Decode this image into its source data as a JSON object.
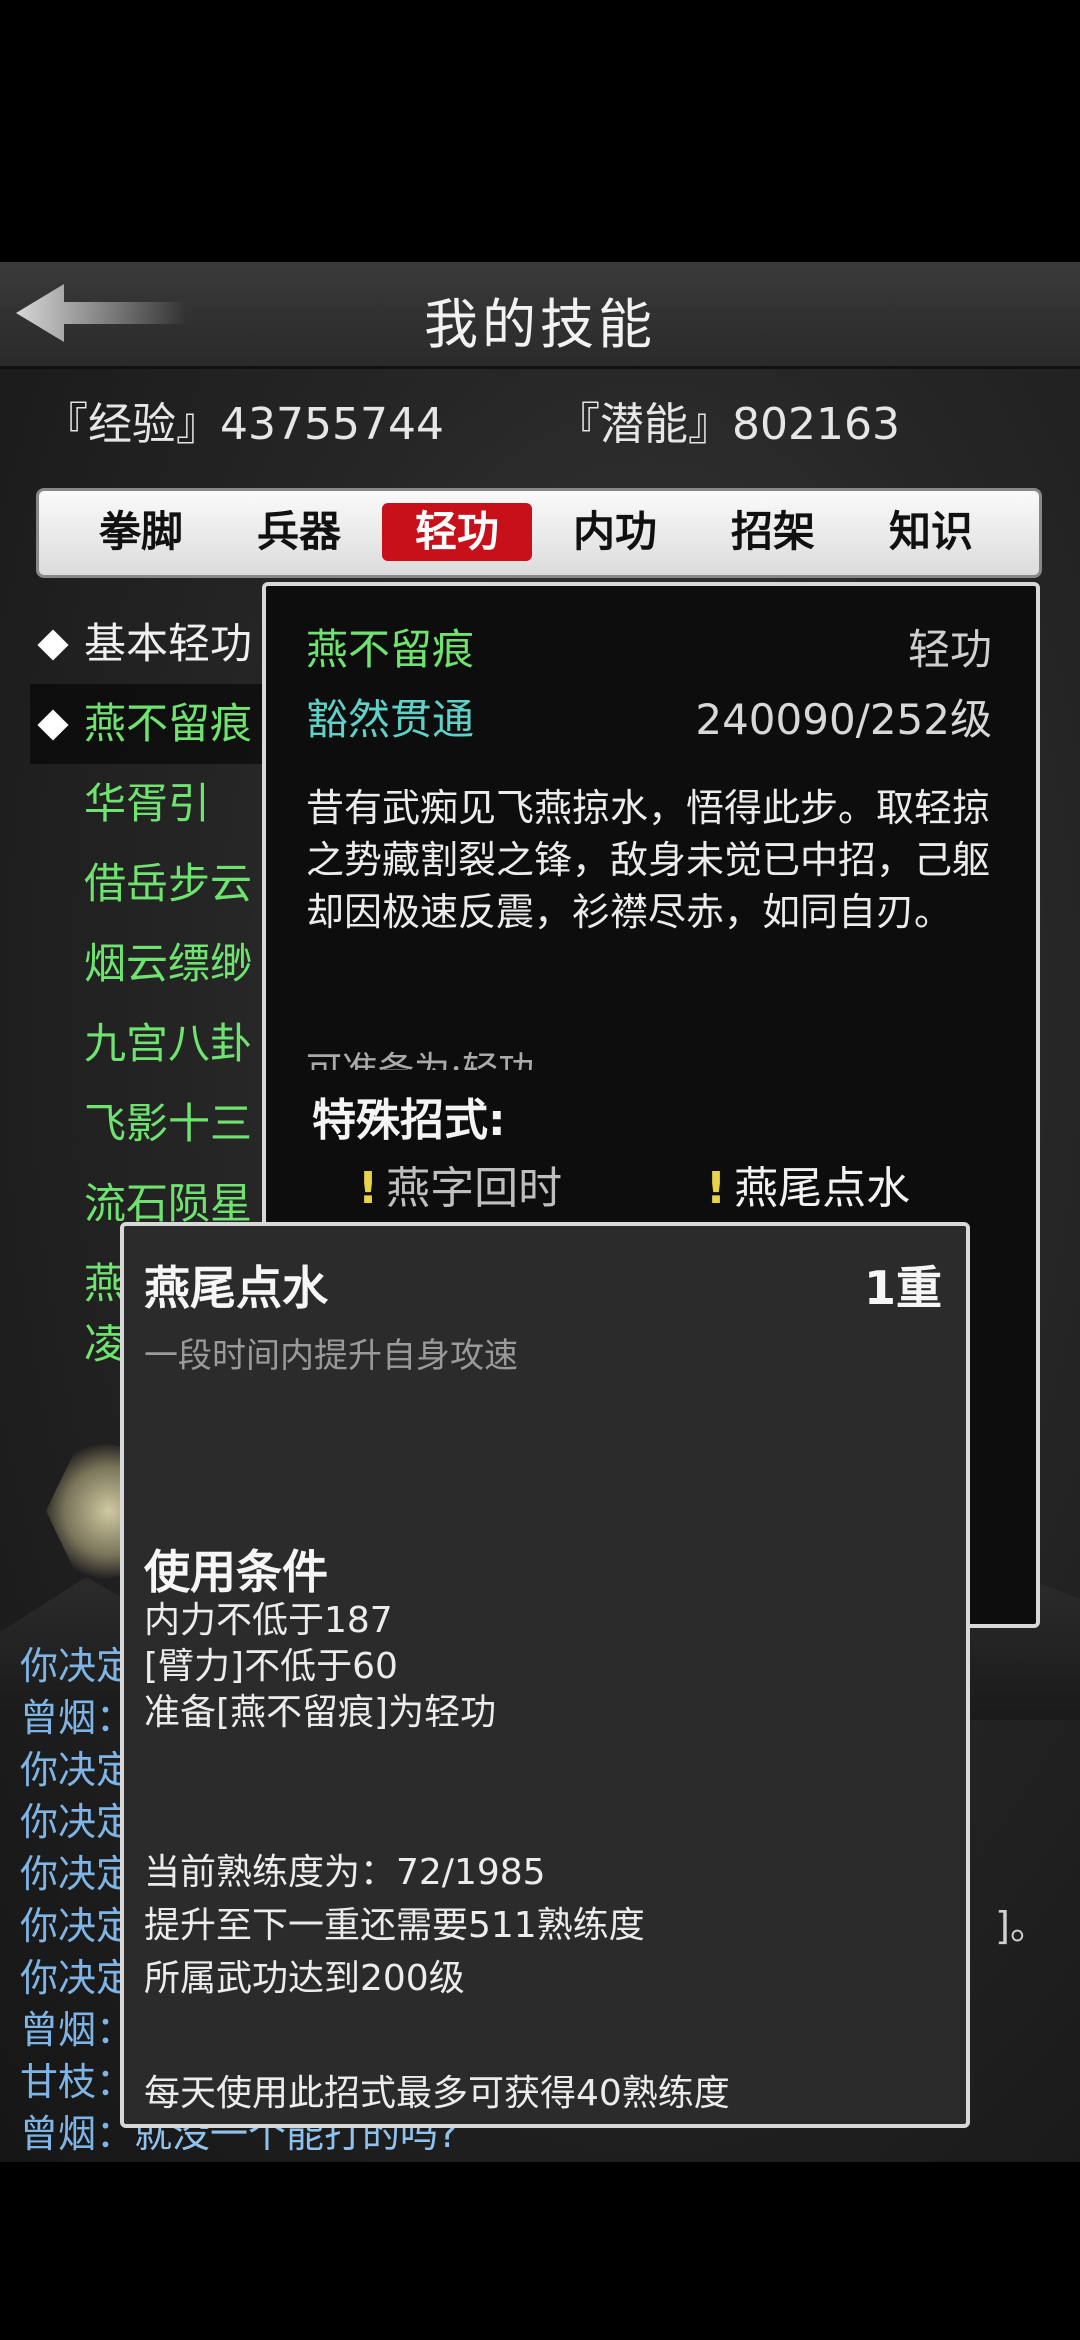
{
  "header": {
    "title": "我的技能"
  },
  "stats": {
    "experience": "『经验』43755744",
    "potential": "『潜能』802163"
  },
  "tabs": [
    {
      "label": "拳脚",
      "active": false
    },
    {
      "label": "兵器",
      "active": false
    },
    {
      "label": "轻功",
      "active": true
    },
    {
      "label": "内功",
      "active": false
    },
    {
      "label": "招架",
      "active": false
    },
    {
      "label": "知识",
      "active": false
    }
  ],
  "skill_list": {
    "groups": [
      {
        "label": "基本轻功"
      },
      {
        "label": "燕不留痕"
      }
    ],
    "items": [
      {
        "label": "华胥引"
      },
      {
        "label": "借岳步云"
      },
      {
        "label": "烟云缥缈"
      },
      {
        "label": "九宫八卦"
      },
      {
        "label": "飞影十三"
      },
      {
        "label": "流石陨星"
      },
      {
        "label": "燕"
      },
      {
        "label": "凌"
      }
    ]
  },
  "detail": {
    "name": "燕不留痕",
    "type": "轻功",
    "rank": "豁然贯通",
    "level": "240090/252级",
    "description": "昔有武痴见飞燕掠水，悟得此步。取轻掠之势藏割裂之锋，敌身未觉已中招，己躯却因极速反震，衫襟尽赤，如同自刃。",
    "equip_hint": "可准备为:轻功",
    "special_title": "特殊招式:",
    "special_moves": [
      {
        "label": "燕字回时"
      },
      {
        "label": "燕尾点水"
      }
    ]
  },
  "tooltip": {
    "name": "燕尾点水",
    "tier": "1重",
    "description": "一段时间内提升自身攻速",
    "conditions_title": "使用条件",
    "conditions": [
      "内力不低于187",
      "[臂力]不低于60",
      "准备[燕不留痕]为轻功"
    ],
    "proficiency": [
      "当前熟练度为：72/1985",
      "提升至下一重还需要511熟练度",
      "所属武功达到200级"
    ],
    "daily": "每天使用此招式最多可获得40熟练度"
  },
  "chat": [
    {
      "speaker": "你决定",
      "text": "",
      "tail": ""
    },
    {
      "speaker": "曾烟：",
      "text": "",
      "tail": ""
    },
    {
      "speaker": "你决定",
      "text": "",
      "tail": ""
    },
    {
      "speaker": "你决定",
      "text": "",
      "tail": ""
    },
    {
      "speaker": "你决定",
      "text": "",
      "tail": ""
    },
    {
      "speaker": "你决定",
      "text": "",
      "tail": "]。"
    },
    {
      "speaker": "你决定",
      "text": "",
      "tail": ""
    },
    {
      "speaker": "曾烟：",
      "text": "",
      "tail": ""
    },
    {
      "speaker": "甘枝：",
      "text": "",
      "tail": ""
    },
    {
      "speaker": "曾烟：",
      "text": "就没一个能打的吗?",
      "tail": ""
    }
  ],
  "colors": {
    "tab_active": "#c8101a",
    "skill_green": "#6fe36f",
    "rank_cyan": "#5fd2c8",
    "chat_blue": "#7fb5e6"
  },
  "icons": {
    "back": "back-arrow-icon",
    "diamond": "diamond-bullet-icon",
    "exclamation": "exclamation-icon"
  }
}
